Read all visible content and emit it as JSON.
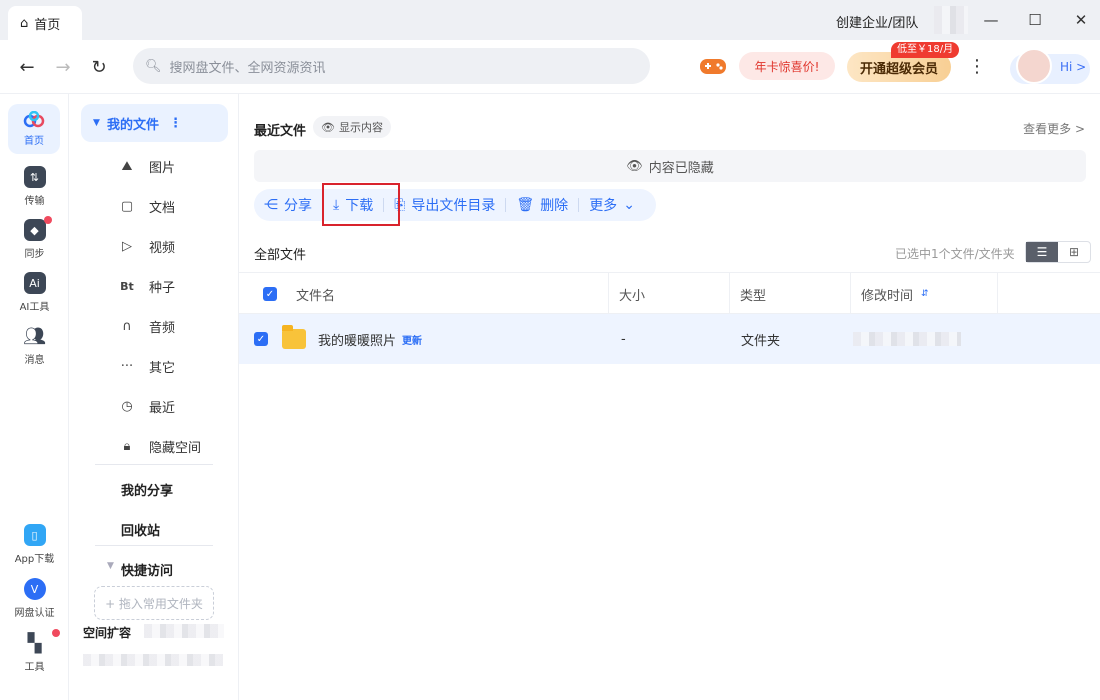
{
  "window": {
    "tab_label": "首页",
    "create_team": "创建企业/团队",
    "min_icon": "minimize-icon",
    "max_icon": "maximize-icon",
    "close_icon": "close-icon"
  },
  "toolbar": {
    "search_placeholder": "搜网盘文件、全网资源资讯",
    "promo_label": "年卡惊喜价!",
    "vip_label": "开通超级会员",
    "vip_badge": "低至￥18/月",
    "hi_label": "Hi >"
  },
  "rail": {
    "items": [
      {
        "label": "首页",
        "icon": "cloud-icon"
      },
      {
        "label": "传输",
        "icon": "transfer-icon"
      },
      {
        "label": "同步",
        "icon": "sync-icon"
      },
      {
        "label": "AI工具",
        "icon": "ai-icon"
      },
      {
        "label": "消息",
        "icon": "message-icon"
      }
    ],
    "bottom_items": [
      {
        "label": "App下载",
        "icon": "phone-icon"
      },
      {
        "label": "网盘认证",
        "icon": "verify-icon"
      },
      {
        "label": "工具",
        "icon": "tools-icon"
      }
    ],
    "accent": "#2c6ef5"
  },
  "sidebar": {
    "my_files": "我的文件",
    "items": [
      {
        "label": "图片",
        "icon": "image-icon"
      },
      {
        "label": "文档",
        "icon": "document-icon"
      },
      {
        "label": "视频",
        "icon": "video-icon"
      },
      {
        "label": "种子",
        "icon": "bt-icon"
      },
      {
        "label": "音频",
        "icon": "headphones-icon"
      },
      {
        "label": "其它",
        "icon": "more-icon"
      },
      {
        "label": "最近",
        "icon": "clock-icon"
      },
      {
        "label": "隐藏空间",
        "icon": "lock-icon"
      }
    ],
    "my_share": "我的分享",
    "recycle": "回收站",
    "quick_access": "快捷访问",
    "drop_zone": "+ 拖入常用文件夹",
    "expand_space": "空间扩容"
  },
  "main": {
    "recent_title": "最近文件",
    "show_content": "显示内容",
    "see_more": "查看更多 >",
    "hidden_notice": "内容已隐藏",
    "actions": {
      "share": "分享",
      "download": "下载",
      "export": "导出文件目录",
      "delete": "删除",
      "more": "更多"
    },
    "all_files": "全部文件",
    "selected_info": "已选中1个文件/文件夹",
    "table": {
      "headers": [
        "文件名",
        "大小",
        "类型",
        "修改时间"
      ],
      "rows": [
        {
          "name": "我的暖暖照片",
          "tag": "更新",
          "size": "-",
          "type": "文件夹",
          "checked": true
        }
      ]
    },
    "highlight_color": "#d9232c"
  }
}
